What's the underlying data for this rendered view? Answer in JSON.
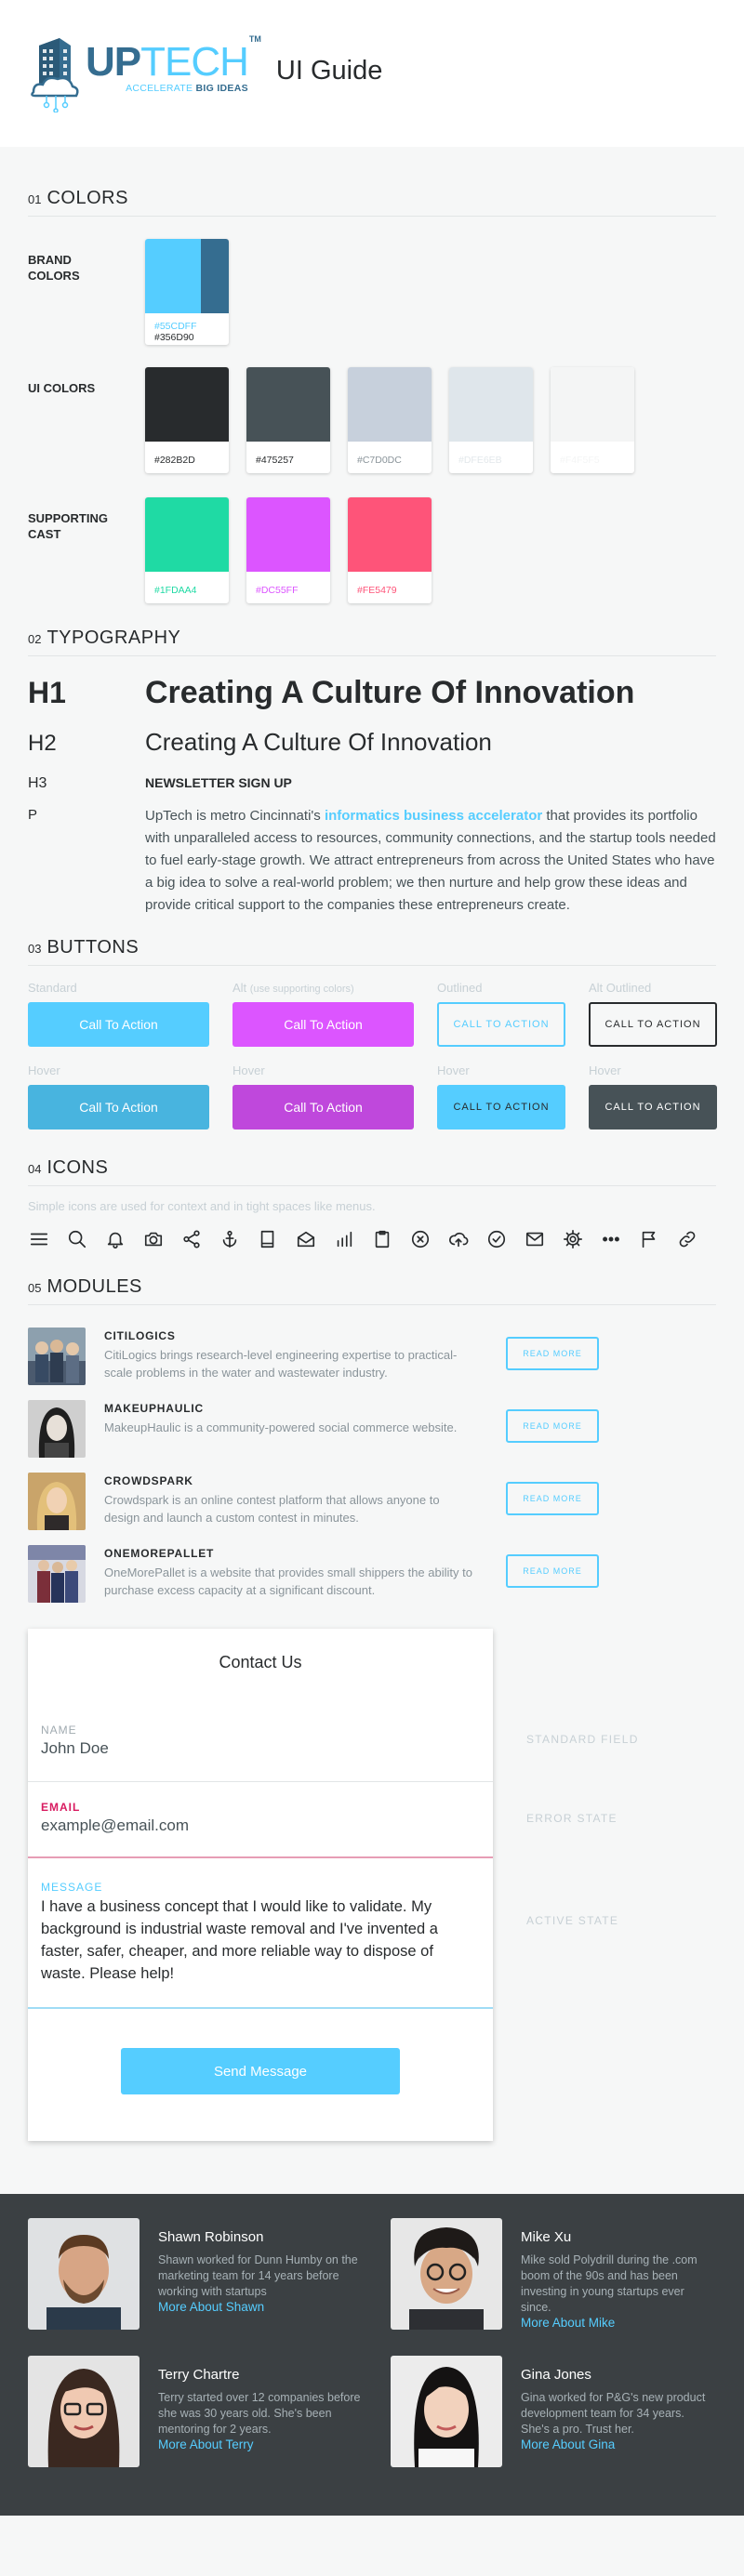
{
  "header": {
    "logo_word_up": "UP",
    "logo_word_tech": "TECH",
    "logo_tm": "TM",
    "logo_tagline_a": "ACCELERATE",
    "logo_tagline_b": "BIG IDEAS",
    "title": "UI Guide"
  },
  "colors": {
    "num": "01",
    "title": "COLORS",
    "brand_label": "BRAND COLORS",
    "brand": {
      "hex1": "#55CDFF",
      "hex2": "#356D90",
      "c1": "#55cdff",
      "c2": "#356d90"
    },
    "ui_label": "UI COLORS",
    "ui": [
      {
        "hex": "#282B2D",
        "color": "#282b2d",
        "text": "#282b2d"
      },
      {
        "hex": "#475257",
        "color": "#475257",
        "text": "#282b2d"
      },
      {
        "hex": "#C7D0DC",
        "color": "#c7d0dc",
        "text": "#8a949a"
      },
      {
        "hex": "#DFE6EB",
        "color": "#dfe6eb",
        "text": "#e8ecef"
      },
      {
        "hex": "#F4F5F5",
        "color": "#f4f5f5",
        "text": "#f4f5f5"
      }
    ],
    "supporting_label": "SUPPORTING CAST",
    "supporting": [
      {
        "hex": "#1FDAA4",
        "color": "#1fdaa4"
      },
      {
        "hex": "#DC55FF",
        "color": "#dc55ff"
      },
      {
        "hex": "#FE5479",
        "color": "#fe5479"
      }
    ]
  },
  "typography": {
    "num": "02",
    "title": "TYPOGRAPHY",
    "h1_label": "H1",
    "h1_text": "Creating A Culture Of Innovation",
    "h2_label": "H2",
    "h2_text": "Creating A Culture Of Innovation",
    "h3_label": "H3",
    "h3_text": "NEWSLETTER SIGN UP",
    "p_label": "P",
    "p_before": "UpTech is metro Cincinnati's ",
    "p_link": "informatics business accelerator",
    "p_after": " that provides its portfolio with unparalleled access to resources, community connections, and the startup tools needed to fuel early-stage growth. We attract entrepreneurs from across the United States who have a big idea to solve a real-world problem; we then nurture and help grow these ideas and provide critical support to the companies these entrepreneurs create."
  },
  "buttons": {
    "num": "03",
    "title": "BUTTONS",
    "cap_standard": "Standard",
    "cap_alt": "Alt",
    "cap_alt_note": "(use supporting colors)",
    "cap_outlined": "Outlined",
    "cap_alt_outlined": "Alt Outlined",
    "cap_hover": "Hover",
    "cta": "Call To Action",
    "cta_caps": "CALL TO ACTION"
  },
  "icons": {
    "num": "04",
    "title": "ICONS",
    "note": "Simple icons are used for context and in tight spaces like menus.",
    "list": [
      "menu-icon",
      "search-icon",
      "bell-icon",
      "camera-icon",
      "share-icon",
      "anchor-icon",
      "book-icon",
      "mail-open-icon",
      "bar-chart-icon",
      "clipboard-icon",
      "close-circle-icon",
      "cloud-upload-icon",
      "check-circle-icon",
      "mail-icon",
      "gear-icon",
      "more-icon",
      "flag-icon",
      "link-icon"
    ]
  },
  "modules": {
    "num": "05",
    "title": "MODULES",
    "read_more": "READ MORE",
    "items": [
      {
        "name": "CITILOGICS",
        "desc": "CitiLogics brings research-level engineering expertise to practical-scale problems in the water and wastewater industry."
      },
      {
        "name": "MAKEUPHAULIC",
        "desc": "MakeupHaulic is a community-powered social commerce website."
      },
      {
        "name": "CROWDSPARK",
        "desc": "Crowdspark is an online contest platform that allows anyone to design and launch a custom contest in minutes."
      },
      {
        "name": "ONEMOREPALLET",
        "desc": "OneMorePallet is a website that provides small shippers the ability to purchase excess capacity at a significant discount."
      }
    ]
  },
  "contact": {
    "title": "Contact Us",
    "name_label": "NAME",
    "name_value": "John Doe",
    "email_label": "EMAIL",
    "email_value": "example@email.com",
    "message_label": "MESSAGE",
    "message_value": "I have a business concept that I would like to validate. My background is industrial waste removal and I've invented a faster, safer, cheaper, and more reliable way to dispose of waste. Please help!",
    "send": "Send Message",
    "standard_field": "STANDARD FIELD",
    "error_state": "ERROR STATE",
    "active_state": "ACTIVE STATE",
    "error_color": "#d81b60"
  },
  "team": [
    {
      "name": "Shawn Robinson",
      "bio": "Shawn worked for Dunn Humby on the marketing team for 14 years before working with startups",
      "link": "More About Shawn"
    },
    {
      "name": "Mike Xu",
      "bio": "Mike sold Polydrill during the .com boom of the 90s and has been investing in young startups ever since.",
      "link": "More About Mike"
    },
    {
      "name": "Terry Chartre",
      "bio": "Terry started over 12 companies before she was 30 years old. She's been mentoring for 2 years.",
      "link": "More About Terry"
    },
    {
      "name": "Gina Jones",
      "bio": "Gina worked for P&G's new product development team for 34 years. She's a pro. Trust her.",
      "link": "More About Gina"
    }
  ]
}
